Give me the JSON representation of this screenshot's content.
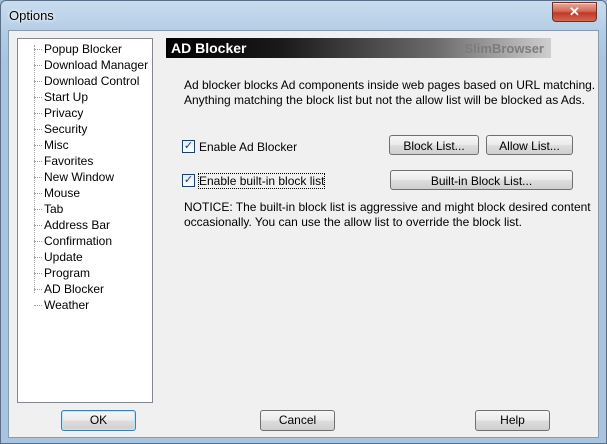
{
  "window": {
    "title": "Options",
    "close_glyph": "✕"
  },
  "tree": {
    "items": [
      {
        "label": "Popup Blocker"
      },
      {
        "label": "Download Manager"
      },
      {
        "label": "Download Control"
      },
      {
        "label": "Start Up"
      },
      {
        "label": "Privacy"
      },
      {
        "label": "Security"
      },
      {
        "label": "Misc"
      },
      {
        "label": "Favorites"
      },
      {
        "label": "New Window"
      },
      {
        "label": "Mouse"
      },
      {
        "label": "Tab"
      },
      {
        "label": "Address Bar"
      },
      {
        "label": "Confirmation"
      },
      {
        "label": "Update"
      },
      {
        "label": "Program"
      },
      {
        "label": "AD Blocker"
      },
      {
        "label": "Weather"
      }
    ],
    "selected": "AD Blocker"
  },
  "panel": {
    "title": "AD Blocker",
    "brand": "SlimBrowser",
    "description_line1": "Ad blocker blocks Ad components inside web pages based on URL matching.",
    "description_line2": "Anything matching the block list but not the allow list will be blocked as Ads.",
    "enable_ad_blocker": {
      "label": "Enable Ad Blocker",
      "checked": true
    },
    "enable_builtin": {
      "label": "Enable built-in block list",
      "checked": true
    },
    "block_list_button": "Block List...",
    "allow_list_button": "Allow List...",
    "builtin_list_button": "Built-in Block List...",
    "notice_line1": "NOTICE: The built-in block list is aggressive and might block desired content",
    "notice_line2": "occasionally. You can use the allow list to override the block list.",
    "check_glyph": "✓"
  },
  "footer": {
    "ok": "OK",
    "cancel": "Cancel",
    "help": "Help"
  },
  "colors": {
    "banner_start": "#000000",
    "banner_end": "#cfcfcf",
    "banner_brand": "#7c7c7c",
    "close_button": "#c0392b"
  }
}
